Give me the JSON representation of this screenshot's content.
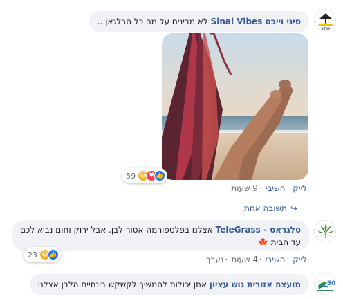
{
  "comments": [
    {
      "author": "סיני וייבס Sinai Vibes",
      "text": "לא מבינים על מה כל הבלגאן...",
      "avatar_icon": "sinai-vibes-logo",
      "reactions": {
        "count": "59",
        "types": [
          "like",
          "love",
          "haha"
        ]
      },
      "actions": {
        "like": "לייק",
        "reply": "השיבי",
        "time": "9 שעות"
      }
    },
    {
      "author": "טלגראס - TeleGrass",
      "text_line1": "אצלנו בפלטפורמה אסור לבן. אבל ירוק וחום נביא לכם",
      "text_line2": "עד הבית",
      "leaf_emoji": "🍁",
      "avatar_icon": "cannabis-leaf-icon",
      "reactions": {
        "count": "23",
        "types": [
          "like",
          "haha"
        ]
      },
      "actions": {
        "like": "לייק",
        "reply": "השיבי",
        "time": "4 שעות",
        "edited": "נערך"
      }
    },
    {
      "author": "מועצה אזורית גוש עציון",
      "text": "אתן יכולות להמשיך לקשקש בינתיים הלבן אצלנו",
      "avatar_icon": "gush-etzion-50-logo"
    }
  ],
  "replies_link": "תשובה אחת",
  "reply_arrow_icon": "reply-arrow-icon",
  "colors": {
    "author": "#385898",
    "bubble": "#f0f2f5",
    "meta": "#606770",
    "like": "#1877f2"
  }
}
